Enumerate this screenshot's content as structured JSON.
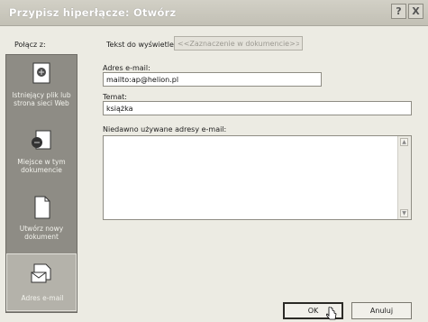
{
  "window": {
    "title": "Przypisz hiperłącze: Otwórz",
    "help_label": "?",
    "close_label": "X"
  },
  "header": {
    "link_to_label": "Połącz z:",
    "display_text_label": "Tekst do wyświetlenia:",
    "display_text_value": "<<Zaznaczenie w dokumencie>>"
  },
  "sidebar": {
    "items": [
      {
        "label": "Istniejący plik lub strona sieci Web",
        "icon": "existing-file-icon",
        "active": false
      },
      {
        "label": "Miejsce w tym dokumencie",
        "icon": "place-in-document-icon",
        "active": false
      },
      {
        "label": "Utwórz nowy dokument",
        "icon": "new-document-icon",
        "active": false
      },
      {
        "label": "Adres e-mail",
        "icon": "email-address-icon",
        "active": true
      }
    ]
  },
  "form": {
    "email_label": "Adres e-mail:",
    "email_value": "mailto:ap@helion.pl",
    "subject_label": "Temat:",
    "subject_value": "książka",
    "recent_label": "Niedawno używane adresy e-mail:"
  },
  "buttons": {
    "ok": "OK",
    "cancel": "Anuluj"
  }
}
